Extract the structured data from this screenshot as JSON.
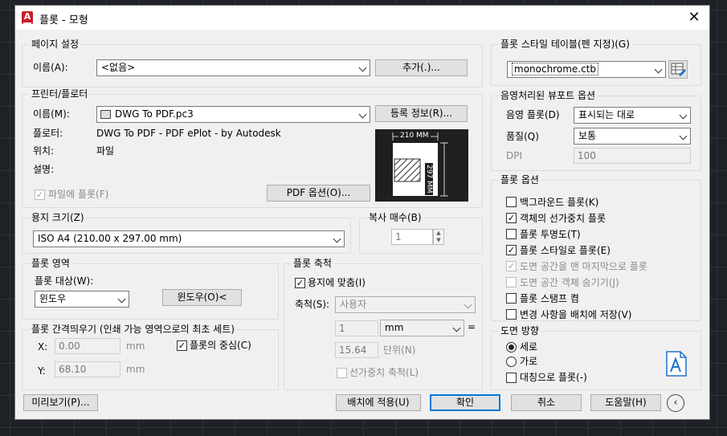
{
  "window": {
    "title": "플롯 - 모형",
    "app_icon": "autocad-a-icon",
    "close": "✕"
  },
  "page_setup": {
    "group": "페이지 설정",
    "name_label": "이름(A):",
    "name_value": "<없음>",
    "add_button": "추가(.)..."
  },
  "printer": {
    "group": "프린터/플로터",
    "name_label": "이름(M):",
    "name_value": "DWG To PDF.pc3",
    "properties_button": "등록 정보(R)...",
    "plotter_label": "플로터:",
    "plotter_value": "DWG To PDF - PDF ePlot - by Autodesk",
    "location_label": "위치:",
    "location_value": "파일",
    "desc_label": "설명:",
    "plot_to_file": "파일에 플롯(F)",
    "pdf_options": "PDF 옵션(O)...",
    "preview_width": "210 MM",
    "preview_height": "297 MM"
  },
  "paper_size": {
    "group": "용지 크기(Z)",
    "value": "ISO A4 (210.00 x 297.00 mm)"
  },
  "copies": {
    "group": "복사 매수(B)",
    "value": "1"
  },
  "plot_area": {
    "group": "플롯 영역",
    "what_label": "플롯 대상(W):",
    "what_value": "윈도우",
    "window_button": "윈도우(O)<"
  },
  "plot_offset": {
    "group": "플롯 간격띄우기 (인쇄 가능 영역으로의 최초 세트)",
    "x_label": "X:",
    "x_value": "0.00",
    "x_unit": "mm",
    "y_label": "Y:",
    "y_value": "68.10",
    "y_unit": "mm",
    "center": "플롯의 중심(C)"
  },
  "plot_scale": {
    "group": "플롯 축척",
    "fit": "용지에 맞춤(I)",
    "scale_label": "축척(S):",
    "scale_value": "사용자",
    "value1": "1",
    "unit": "mm",
    "equals": "=",
    "value2": "15.64",
    "unit2": "단위(N)",
    "lineweights": "선가중치 축척(L)"
  },
  "style_table": {
    "group": "플롯 스타일 테이블(펜 지정)(G)",
    "value": "monochrome.ctb",
    "edit_icon": "edit-table-icon"
  },
  "shaded": {
    "group": "음영처리된 뷰포트 옵션",
    "shade_label": "음영 플롯(D)",
    "shade_value": "표시되는 대로",
    "quality_label": "품질(Q)",
    "quality_value": "보통",
    "dpi_label": "DPI",
    "dpi_value": "100"
  },
  "options": {
    "group": "플롯 옵션",
    "items": [
      {
        "label": "백그라운드 플롯(K)",
        "checked": false,
        "enabled": true
      },
      {
        "label": "객체의 선가중치 플롯",
        "checked": true,
        "enabled": true
      },
      {
        "label": "플롯 투명도(T)",
        "checked": false,
        "enabled": true
      },
      {
        "label": "플롯 스타일로 플롯(E)",
        "checked": true,
        "enabled": true
      },
      {
        "label": "도면 공간을 맨 마지막으로 플롯",
        "checked": true,
        "enabled": false
      },
      {
        "label": "도면 공간 객체 숨기기(J)",
        "checked": false,
        "enabled": false
      },
      {
        "label": "플롯 스탬프 켬",
        "checked": false,
        "enabled": true
      },
      {
        "label": "변경 사항을 배치에 저장(V)",
        "checked": false,
        "enabled": true
      }
    ]
  },
  "orientation": {
    "group": "도면 방향",
    "portrait": "세로",
    "landscape": "가로",
    "upside_down": "대칭으로 플롯(-)",
    "icon": "portrait-page-icon"
  },
  "footer": {
    "preview": "미리보기(P)...",
    "apply": "배치에 적용(U)",
    "ok": "확인",
    "cancel": "취소",
    "help": "도움말(H)",
    "collapse_icon": "collapse-arrow-icon"
  },
  "colors": {
    "accent": "#0078d7",
    "preview_bg": "#1f1f1f",
    "orient_icon": "#1e74c8"
  }
}
